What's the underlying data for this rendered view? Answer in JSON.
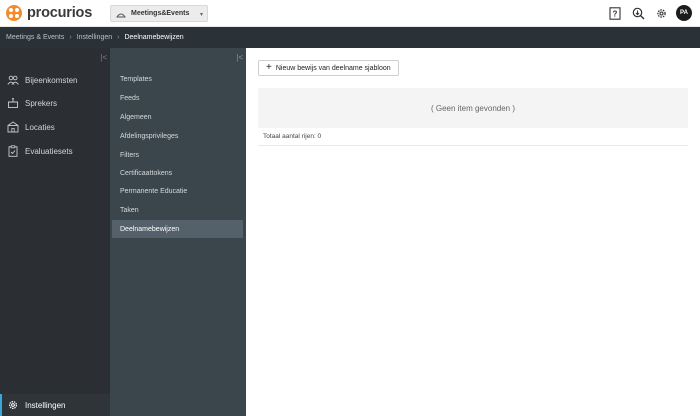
{
  "app": {
    "logo_text": "procurios",
    "module_label": "Meetings&Events",
    "brand_color": "#f28a2e",
    "accent_color": "#3aa7d8"
  },
  "header": {
    "icons": [
      "help-icon",
      "search-icon",
      "gear-icon"
    ],
    "avatar_initials": "PA"
  },
  "breadcrumb": {
    "items": [
      "Meetings & Events",
      "Instellingen",
      "Deelnamebewijzen"
    ],
    "separator": "›"
  },
  "sidebar": {
    "collapse_glyph": "|<",
    "items": [
      {
        "label": "Bijeenkomsten",
        "icon": "people-icon"
      },
      {
        "label": "Sprekers",
        "icon": "podium-icon"
      },
      {
        "label": "Locaties",
        "icon": "building-icon"
      },
      {
        "label": "Evaluatiesets",
        "icon": "clipboard-icon"
      }
    ],
    "bottom_item": {
      "label": "Instellingen",
      "icon": "gear-icon"
    }
  },
  "subnav": {
    "collapse_glyph": "|<",
    "items": [
      {
        "label": "Templates"
      },
      {
        "label": "Feeds"
      },
      {
        "label": "Algemeen"
      },
      {
        "label": "Afdelingsprivileges"
      },
      {
        "label": "Filters"
      },
      {
        "label": "Certificaattokens"
      },
      {
        "label": "Permanente Educatie"
      },
      {
        "label": "Taken"
      },
      {
        "label": "Deelnamebewijzen",
        "active": true
      }
    ]
  },
  "main": {
    "new_button_icon": "+",
    "new_button_label": "Nieuw bewijs van deelname sjabloon",
    "empty_message": "( Geen item gevonden )",
    "row_count_label": "Totaal aantal rijen: 0"
  }
}
